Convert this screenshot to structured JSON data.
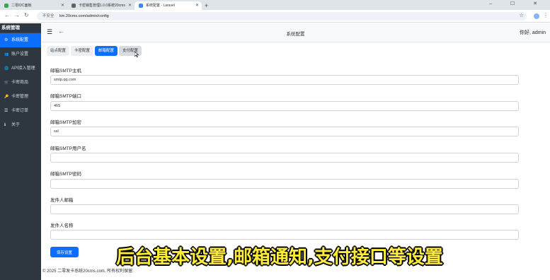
{
  "browser": {
    "tabs": [
      {
        "title": "二零IDC面板",
        "fav_color": "#34a853"
      },
      {
        "title": "卡密销售管理1.0.0系统20cms",
        "fav_color": "#5f6368"
      },
      {
        "title": "系统配置 - Laravel",
        "fav_color": "#4285f4"
      }
    ],
    "secure_label": "不安全",
    "url": "km.20cms.com/admin/config"
  },
  "sidebar": {
    "brand": "系统管理",
    "items": [
      {
        "label": "系统配置",
        "icon": "gear-icon",
        "glyph": "⚙"
      },
      {
        "label": "账户设置",
        "icon": "users-icon",
        "glyph": "👥"
      },
      {
        "label": "API接入管理",
        "icon": "globe-icon",
        "glyph": "🌐"
      },
      {
        "label": "卡密商品",
        "icon": "cart-icon",
        "glyph": "🛒"
      },
      {
        "label": "卡密管理",
        "icon": "key-icon",
        "glyph": "🔑"
      },
      {
        "label": "卡密订单",
        "icon": "list-icon",
        "glyph": "☰"
      },
      {
        "label": "关于",
        "icon": "info-icon",
        "glyph": "ℹ"
      }
    ]
  },
  "header": {
    "title": "系统配置",
    "greeting": "你好, admin"
  },
  "tabs": [
    "站点配置",
    "卡密配置",
    "邮箱配置",
    "支付配置"
  ],
  "form": {
    "fields": [
      {
        "label": "邮箱SMTP主机",
        "value": "smtp.qq.com"
      },
      {
        "label": "邮箱SMTP端口",
        "value": "465"
      },
      {
        "label": "邮箱SMTP加密",
        "value": "ssl"
      },
      {
        "label": "邮箱SMTP用户名",
        "value": ""
      },
      {
        "label": "邮箱SMTP密码",
        "value": ""
      },
      {
        "label": "发件人邮箱",
        "value": ""
      },
      {
        "label": "发件人名称",
        "value": ""
      }
    ],
    "save_label": "保存设置"
  },
  "footer": "© 2025 二零发卡系统20cms.com. 所有权利保留.",
  "caption": "后台基本设置,邮箱通知,支付接口等设置"
}
